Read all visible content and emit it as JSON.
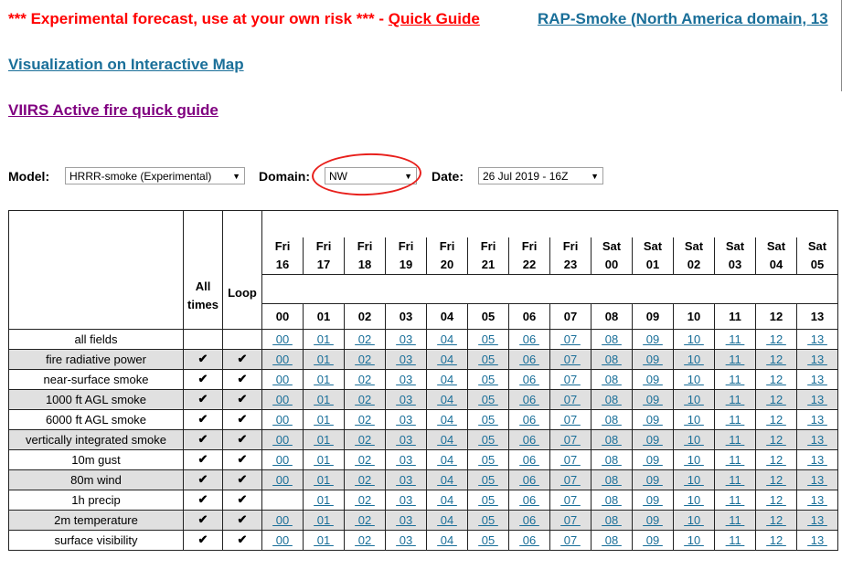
{
  "header": {
    "warning": "*** Experimental forecast, use at your own risk *** -",
    "quick_guide": "Quick Guide",
    "rap_link": "RAP-Smoke (North America domain, 13",
    "viz_link": "Visualization on Interactive Map",
    "viirs_link": "VIIRS Active fire quick guide"
  },
  "controls": {
    "model_label": "Model:",
    "model_value": "HRRR-smoke (Experimental)",
    "domain_label": "Domain:",
    "domain_value": "NW",
    "date_label": "Date:",
    "date_value": "26 Jul 2019 - 16Z",
    "arrow": "▼"
  },
  "table": {
    "all_times_label": "All times",
    "loop_label": "Loop",
    "days": [
      {
        "d": "Fri",
        "n": "16"
      },
      {
        "d": "Fri",
        "n": "17"
      },
      {
        "d": "Fri",
        "n": "18"
      },
      {
        "d": "Fri",
        "n": "19"
      },
      {
        "d": "Fri",
        "n": "20"
      },
      {
        "d": "Fri",
        "n": "21"
      },
      {
        "d": "Fri",
        "n": "22"
      },
      {
        "d": "Fri",
        "n": "23"
      },
      {
        "d": "Sat",
        "n": "00"
      },
      {
        "d": "Sat",
        "n": "01"
      },
      {
        "d": "Sat",
        "n": "02"
      },
      {
        "d": "Sat",
        "n": "03"
      },
      {
        "d": "Sat",
        "n": "04"
      },
      {
        "d": "Sat",
        "n": "05"
      }
    ],
    "hours": [
      "00",
      "01",
      "02",
      "03",
      "04",
      "05",
      "06",
      "07",
      "08",
      "09",
      "10",
      "11",
      "12",
      "13"
    ],
    "check": "✔",
    "rows": [
      {
        "label": "all fields",
        "checks": false,
        "missing00": false,
        "gray": false
      },
      {
        "label": "fire radiative power",
        "checks": true,
        "missing00": false,
        "gray": true
      },
      {
        "label": "near-surface smoke",
        "checks": true,
        "missing00": false,
        "gray": false
      },
      {
        "label": "1000 ft AGL smoke",
        "checks": true,
        "missing00": false,
        "gray": true
      },
      {
        "label": "6000 ft AGL smoke",
        "checks": true,
        "missing00": false,
        "gray": false
      },
      {
        "label": "vertically integrated smoke",
        "checks": true,
        "missing00": false,
        "gray": true
      },
      {
        "label": "10m gust",
        "checks": true,
        "missing00": false,
        "gray": false
      },
      {
        "label": "80m wind",
        "checks": true,
        "missing00": false,
        "gray": true
      },
      {
        "label": "1h precip",
        "checks": true,
        "missing00": true,
        "gray": false
      },
      {
        "label": "2m temperature",
        "checks": true,
        "missing00": false,
        "gray": true
      },
      {
        "label": "surface visibility",
        "checks": true,
        "missing00": false,
        "gray": false
      }
    ]
  }
}
